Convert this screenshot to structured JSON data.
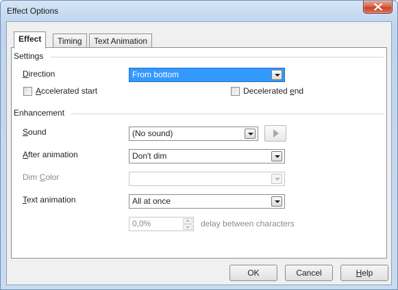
{
  "window": {
    "title": "Effect Options"
  },
  "tabs": [
    {
      "label": "Effect",
      "active": true
    },
    {
      "label": "Timing",
      "active": false
    },
    {
      "label": "Text Animation",
      "active": false
    }
  ],
  "settings": {
    "group_label": "Settings",
    "direction": {
      "label_first": "D",
      "label_rest": "irection",
      "value": "From bottom"
    },
    "accelerated_start": {
      "label_first": "A",
      "label_rest": "ccelerated start",
      "checked": false
    },
    "decelerated_end": {
      "label_pre": "Decelerated ",
      "label_first": "e",
      "label_rest": "nd",
      "checked": false
    }
  },
  "enhancement": {
    "group_label": "Enhancement",
    "sound": {
      "label_first": "S",
      "label_rest": "ound",
      "value": "(No sound)"
    },
    "after_animation": {
      "label_first": "A",
      "label_rest": "fter animation",
      "value": "Don't dim"
    },
    "dim_color": {
      "label_pre": "Dim ",
      "label_first": "C",
      "label_rest": "olor",
      "value": ""
    },
    "text_animation": {
      "label_first": "T",
      "label_rest": "ext animation",
      "value": "All at once"
    },
    "delay": {
      "value": "0,0%",
      "suffix": "delay between characters"
    }
  },
  "buttons": {
    "ok": "OK",
    "cancel": "Cancel",
    "help_first": "H",
    "help_rest": "elp"
  },
  "colors": {
    "selected_highlight": "#3399ff",
    "close_button": "#c9442b"
  },
  "icons": [
    "close-icon",
    "dropdown-arrow-icon",
    "play-icon",
    "spin-up-icon",
    "spin-down-icon"
  ]
}
